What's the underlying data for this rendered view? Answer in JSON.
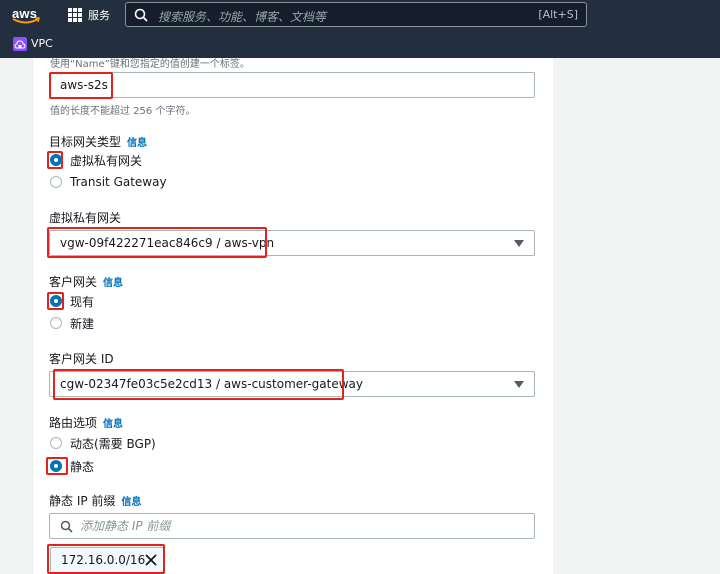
{
  "nav": {
    "logo": "aws",
    "services_label": "服务",
    "search_placeholder": "搜索服务、功能、博客、文档等",
    "search_shortcut": "[Alt+S]"
  },
  "subnav": {
    "label": "VPC"
  },
  "form": {
    "name_hint": "使用“Name”键和您指定的值创建一个标签。",
    "name_value": "aws-s2s",
    "name_limit": "值的长度不能超过 256 个字符。",
    "target_gw_type": {
      "label": "目标网关类型",
      "info": "信息",
      "options": [
        "虚拟私有网关",
        "Transit Gateway"
      ],
      "selected": "虚拟私有网关"
    },
    "vgw": {
      "label": "虚拟私有网关",
      "value": "vgw-09f422271eac846c9 / aws-vpn"
    },
    "customer_gw": {
      "label": "客户网关",
      "info": "信息",
      "options": [
        "现有",
        "新建"
      ],
      "selected": "现有"
    },
    "customer_gw_id": {
      "label": "客户网关 ID",
      "value": "cgw-02347fe03c5e2cd13 / aws-customer-gateway"
    },
    "routing": {
      "label": "路由选项",
      "info": "信息",
      "options": [
        "动态(需要 BGP)",
        "静态"
      ],
      "selected": "静态"
    },
    "static_prefix": {
      "label": "静态 IP 前缀",
      "info": "信息",
      "placeholder": "添加静态 IP 前缀",
      "tokens": [
        "172.16.0.0/16"
      ]
    }
  },
  "colors": {
    "nav_bg": "#232f3e",
    "accent": "#0073bb",
    "highlight": "#e0231b",
    "vpc_icon": "#8c4fff"
  }
}
